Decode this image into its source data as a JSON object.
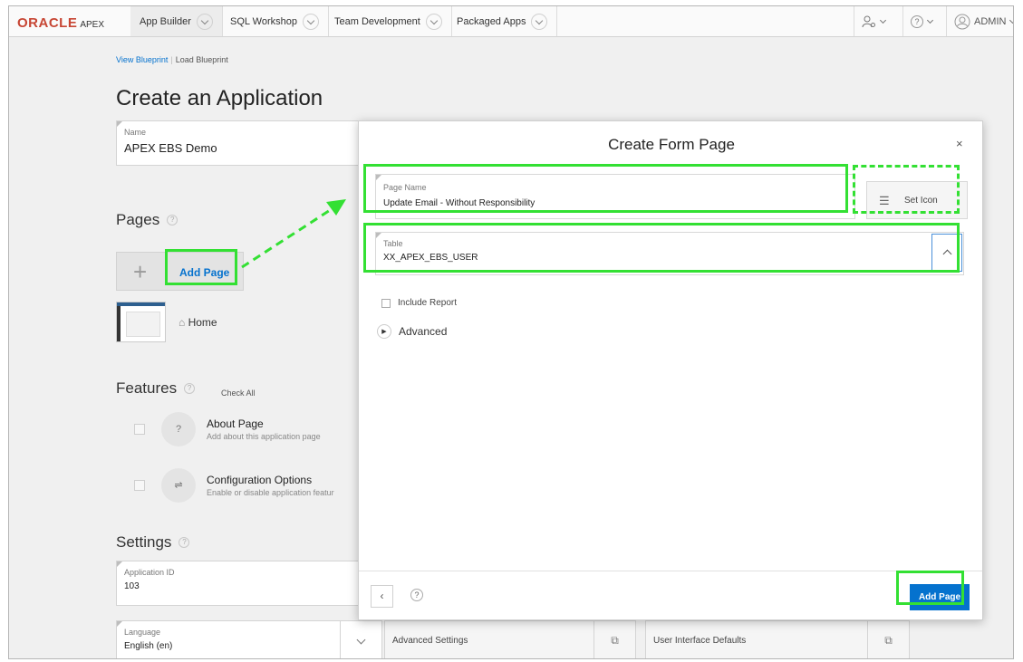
{
  "brand": {
    "name": "ORACLE",
    "product": "APEX"
  },
  "nav": {
    "tabs": [
      "App Builder",
      "SQL Workshop",
      "Team Development",
      "Packaged Apps"
    ],
    "user": "ADMIN",
    "help_glyph": "?"
  },
  "blueprint": {
    "view": "View Blueprint",
    "load": "Load Blueprint"
  },
  "page_title": "Create an Application",
  "app_name": {
    "label": "Name",
    "value": "APEX EBS Demo"
  },
  "pages": {
    "heading": "Pages",
    "add_page": "Add Page",
    "home": "Home"
  },
  "features": {
    "heading": "Features",
    "check_all": "Check All",
    "items": [
      {
        "title": "About Page",
        "desc": "Add about this application page"
      },
      {
        "title": "Configuration Options",
        "desc": "Enable or disable application featur"
      }
    ]
  },
  "settings": {
    "heading": "Settings",
    "app_id_label": "Application ID",
    "app_id_value": "103",
    "language_label": "Language",
    "language_value": "English (en)",
    "advanced": "Advanced Settings",
    "ui_defaults": "User Interface Defaults"
  },
  "modal": {
    "title": "Create Form Page",
    "close": "×",
    "page_name_label": "Page Name",
    "page_name_value": "Update Email - Without Responsibility",
    "set_icon": "Set Icon",
    "table_label": "Table",
    "table_value": "XX_APEX_EBS_USER",
    "include_report": "Include Report",
    "advanced": "Advanced",
    "add_page": "Add Page",
    "prev": "‹"
  },
  "colors": {
    "accent": "#0572ce",
    "annotation": "#33e033",
    "brand": "#c74634"
  }
}
